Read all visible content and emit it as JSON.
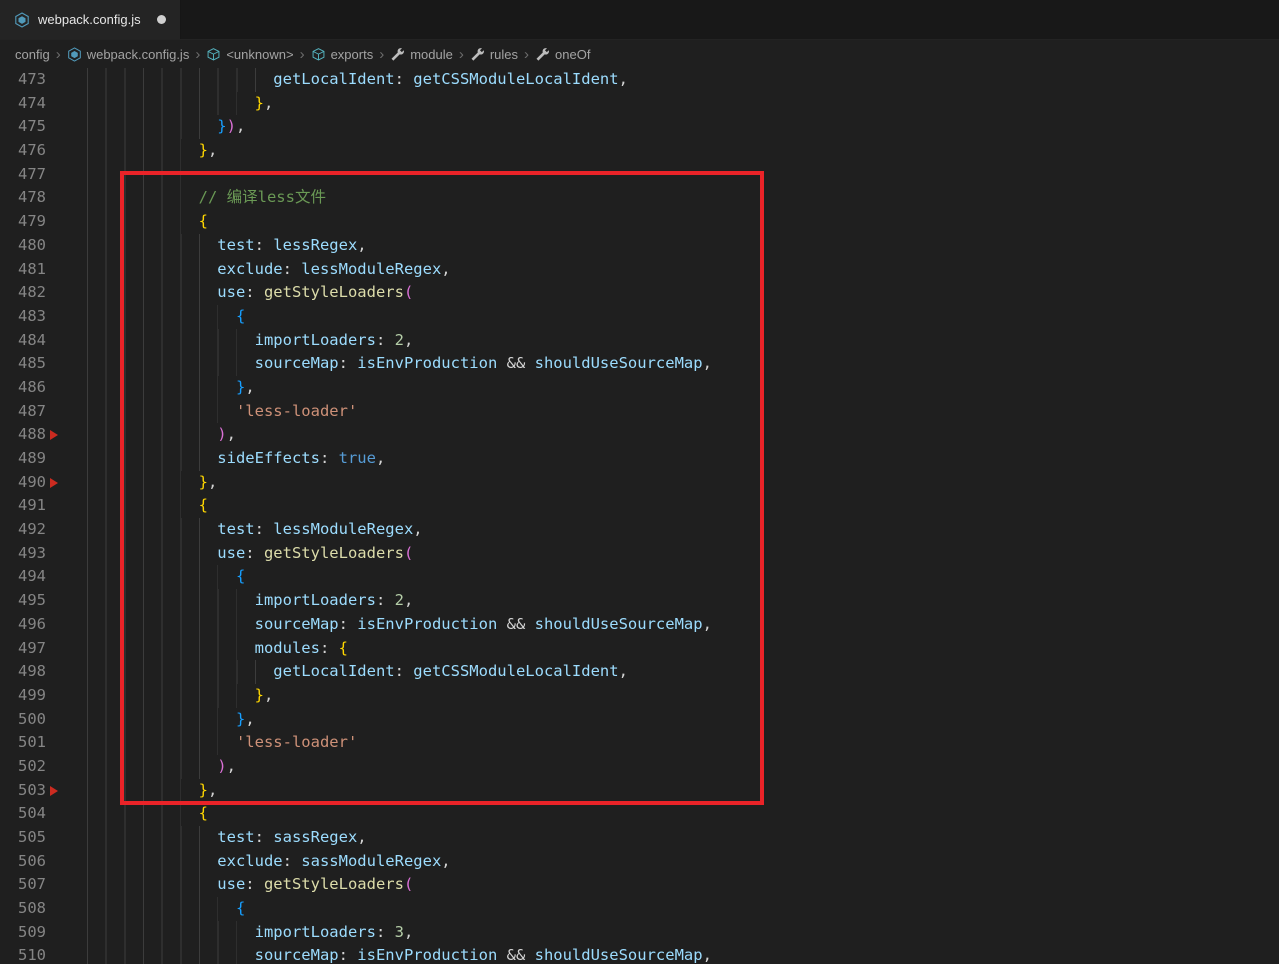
{
  "tab": {
    "title": "webpack.config.js",
    "modified": true
  },
  "breadcrumbs": {
    "items": [
      {
        "label": "config",
        "icon": ""
      },
      {
        "label": "webpack.config.js",
        "icon": "webpack"
      },
      {
        "label": "<unknown>",
        "icon": "namespace"
      },
      {
        "label": "exports",
        "icon": "namespace"
      },
      {
        "label": "module",
        "icon": "wrench"
      },
      {
        "label": "rules",
        "icon": "wrench"
      },
      {
        "label": "oneOf",
        "icon": "wrench"
      }
    ]
  },
  "colors": {
    "fg": "#d4d4d4",
    "key": "#9cdcfe",
    "fn": "#dcdcaa",
    "num": "#b5cea8",
    "str": "#ce9178",
    "kw": "#569cd6",
    "cmt": "#6a9955",
    "b1": "#ffd700",
    "b2": "#da70d6",
    "b3": "#179fff",
    "annotation_red": "#ea2328",
    "marker_red": "#cc2b20"
  },
  "editor": {
    "first_line": 473,
    "marked_lines": [
      488,
      490,
      503
    ],
    "annotation_highlight_lines": "477-503",
    "lines": [
      {
        "n": 473,
        "i": 22,
        "t": [
          [
            "getLocalIdent",
            "key"
          ],
          [
            ": ",
            "fg"
          ],
          [
            "getCSSModuleLocalIdent",
            "key"
          ],
          [
            ",",
            "fg"
          ]
        ]
      },
      {
        "n": 474,
        "i": 20,
        "t": [
          [
            "}",
            "b1"
          ],
          [
            ",",
            "fg"
          ]
        ]
      },
      {
        "n": 475,
        "i": 16,
        "t": [
          [
            "}",
            "b3"
          ],
          [
            ")",
            "b2"
          ],
          [
            ",",
            "fg"
          ]
        ]
      },
      {
        "n": 476,
        "i": 14,
        "t": [
          [
            "}",
            "b1"
          ],
          [
            ",",
            "fg"
          ]
        ]
      },
      {
        "n": 477,
        "i": 14,
        "t": []
      },
      {
        "n": 478,
        "i": 14,
        "t": [
          [
            "// 编译less文件",
            "cmt"
          ]
        ]
      },
      {
        "n": 479,
        "i": 14,
        "t": [
          [
            "{",
            "b1"
          ]
        ]
      },
      {
        "n": 480,
        "i": 16,
        "t": [
          [
            "test",
            "key"
          ],
          [
            ": ",
            "fg"
          ],
          [
            "lessRegex",
            "key"
          ],
          [
            ",",
            "fg"
          ]
        ]
      },
      {
        "n": 481,
        "i": 16,
        "t": [
          [
            "exclude",
            "key"
          ],
          [
            ": ",
            "fg"
          ],
          [
            "lessModuleRegex",
            "key"
          ],
          [
            ",",
            "fg"
          ]
        ]
      },
      {
        "n": 482,
        "i": 16,
        "t": [
          [
            "use",
            "key"
          ],
          [
            ": ",
            "fg"
          ],
          [
            "getStyleLoaders",
            "fn"
          ],
          [
            "(",
            "b2"
          ]
        ]
      },
      {
        "n": 483,
        "i": 18,
        "t": [
          [
            "{",
            "b3"
          ]
        ]
      },
      {
        "n": 484,
        "i": 20,
        "t": [
          [
            "importLoaders",
            "key"
          ],
          [
            ": ",
            "fg"
          ],
          [
            "2",
            "num"
          ],
          [
            ",",
            "fg"
          ]
        ]
      },
      {
        "n": 485,
        "i": 20,
        "t": [
          [
            "sourceMap",
            "key"
          ],
          [
            ": ",
            "fg"
          ],
          [
            "isEnvProduction",
            "key"
          ],
          [
            " && ",
            "fg"
          ],
          [
            "shouldUseSourceMap",
            "key"
          ],
          [
            ",",
            "fg"
          ]
        ]
      },
      {
        "n": 486,
        "i": 18,
        "t": [
          [
            "}",
            "b3"
          ],
          [
            ",",
            "fg"
          ]
        ]
      },
      {
        "n": 487,
        "i": 18,
        "t": [
          [
            "'less-loader'",
            "str"
          ]
        ]
      },
      {
        "n": 488,
        "i": 16,
        "t": [
          [
            ")",
            "b2"
          ],
          [
            ",",
            "fg"
          ]
        ]
      },
      {
        "n": 489,
        "i": 16,
        "t": [
          [
            "sideEffects",
            "key"
          ],
          [
            ": ",
            "fg"
          ],
          [
            "true",
            "kw"
          ],
          [
            ",",
            "fg"
          ]
        ]
      },
      {
        "n": 490,
        "i": 14,
        "t": [
          [
            "}",
            "b1"
          ],
          [
            ",",
            "fg"
          ]
        ]
      },
      {
        "n": 491,
        "i": 14,
        "t": [
          [
            "{",
            "b1"
          ]
        ]
      },
      {
        "n": 492,
        "i": 16,
        "t": [
          [
            "test",
            "key"
          ],
          [
            ": ",
            "fg"
          ],
          [
            "lessModuleRegex",
            "key"
          ],
          [
            ",",
            "fg"
          ]
        ]
      },
      {
        "n": 493,
        "i": 16,
        "t": [
          [
            "use",
            "key"
          ],
          [
            ": ",
            "fg"
          ],
          [
            "getStyleLoaders",
            "fn"
          ],
          [
            "(",
            "b2"
          ]
        ]
      },
      {
        "n": 494,
        "i": 18,
        "t": [
          [
            "{",
            "b3"
          ]
        ]
      },
      {
        "n": 495,
        "i": 20,
        "t": [
          [
            "importLoaders",
            "key"
          ],
          [
            ": ",
            "fg"
          ],
          [
            "2",
            "num"
          ],
          [
            ",",
            "fg"
          ]
        ]
      },
      {
        "n": 496,
        "i": 20,
        "t": [
          [
            "sourceMap",
            "key"
          ],
          [
            ": ",
            "fg"
          ],
          [
            "isEnvProduction",
            "key"
          ],
          [
            " && ",
            "fg"
          ],
          [
            "shouldUseSourceMap",
            "key"
          ],
          [
            ",",
            "fg"
          ]
        ]
      },
      {
        "n": 497,
        "i": 20,
        "t": [
          [
            "modules",
            "key"
          ],
          [
            ": ",
            "fg"
          ],
          [
            "{",
            "b1"
          ]
        ]
      },
      {
        "n": 498,
        "i": 22,
        "t": [
          [
            "getLocalIdent",
            "key"
          ],
          [
            ": ",
            "fg"
          ],
          [
            "getCSSModuleLocalIdent",
            "key"
          ],
          [
            ",",
            "fg"
          ]
        ]
      },
      {
        "n": 499,
        "i": 20,
        "t": [
          [
            "}",
            "b1"
          ],
          [
            ",",
            "fg"
          ]
        ]
      },
      {
        "n": 500,
        "i": 18,
        "t": [
          [
            "}",
            "b3"
          ],
          [
            ",",
            "fg"
          ]
        ]
      },
      {
        "n": 501,
        "i": 18,
        "t": [
          [
            "'less-loader'",
            "str"
          ]
        ]
      },
      {
        "n": 502,
        "i": 16,
        "t": [
          [
            ")",
            "b2"
          ],
          [
            ",",
            "fg"
          ]
        ]
      },
      {
        "n": 503,
        "i": 14,
        "t": [
          [
            "}",
            "b1"
          ],
          [
            ",",
            "fg"
          ]
        ]
      },
      {
        "n": 504,
        "i": 14,
        "t": [
          [
            "{",
            "b1"
          ]
        ]
      },
      {
        "n": 505,
        "i": 16,
        "t": [
          [
            "test",
            "key"
          ],
          [
            ": ",
            "fg"
          ],
          [
            "sassRegex",
            "key"
          ],
          [
            ",",
            "fg"
          ]
        ]
      },
      {
        "n": 506,
        "i": 16,
        "t": [
          [
            "exclude",
            "key"
          ],
          [
            ": ",
            "fg"
          ],
          [
            "sassModuleRegex",
            "key"
          ],
          [
            ",",
            "fg"
          ]
        ]
      },
      {
        "n": 507,
        "i": 16,
        "t": [
          [
            "use",
            "key"
          ],
          [
            ": ",
            "fg"
          ],
          [
            "getStyleLoaders",
            "fn"
          ],
          [
            "(",
            "b2"
          ]
        ]
      },
      {
        "n": 508,
        "i": 18,
        "t": [
          [
            "{",
            "b3"
          ]
        ]
      },
      {
        "n": 509,
        "i": 20,
        "t": [
          [
            "importLoaders",
            "key"
          ],
          [
            ": ",
            "fg"
          ],
          [
            "3",
            "num"
          ],
          [
            ",",
            "fg"
          ]
        ]
      },
      {
        "n": 510,
        "i": 20,
        "t": [
          [
            "sourceMap",
            "key"
          ],
          [
            ": ",
            "fg"
          ],
          [
            "isEnvProduction",
            "key"
          ],
          [
            " && ",
            "fg"
          ],
          [
            "shouldUseSourceMap",
            "key"
          ],
          [
            ",",
            "fg"
          ]
        ]
      }
    ]
  }
}
